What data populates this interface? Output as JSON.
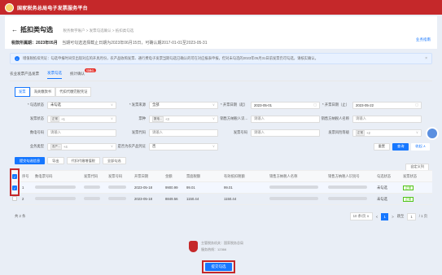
{
  "app": {
    "title": "国家税务总局电子发票服务平台"
  },
  "header": {
    "back_label": "抵扣类勾选",
    "breadcrumb": "税务数字账户 > 发票勾选确认 > 抵扣类勾选",
    "period_label": "税款所属期：",
    "period_value": "2023年05月",
    "period_note": "当期可勾选选择截止日期为2023年06月15日，可确认期2017-01-01至2023-05-31",
    "help": "业务指南"
  },
  "notice": {
    "text": "增值税抵扣凭证：勾选申报时间仅出现对应的开具月份，农产品收购发票、通行费电子发票当期勾选已确认的可在对应报表申报，但对未勾选的2023年05月31日前发票仍可勾选，请核实确认。",
    "close": "×"
  },
  "tabs_main": [
    {
      "label": "农业发票产品发票",
      "active": false
    },
    {
      "label": "发票勾选",
      "active": true
    },
    {
      "label": "统计确认",
      "active": false,
      "badge": "待确认"
    }
  ],
  "tabs_sub": [
    "发票",
    "海关缴款书",
    "代扣代缴完税凭证"
  ],
  "form": {
    "row1": [
      {
        "label": "* 勾选状态",
        "value": "未勾选",
        "suffix": "∨",
        "is_value": true
      },
      {
        "label": "* 发票来源",
        "value": "全部",
        "suffix": "∨",
        "is_value": true
      },
      {
        "label": "* 开票日期（起）",
        "value": "2023-05-01",
        "suffix": "▢",
        "is_value": true
      },
      {
        "label": "* 开票日期（止）",
        "value": "2023-05-22",
        "suffix": "▢",
        "is_value": true
      }
    ],
    "row2": [
      {
        "label": "发票状态",
        "tag": "正常",
        "value": "+1",
        "suffix": "∨"
      },
      {
        "label": "票种",
        "tag": "数电...",
        "value": "+3",
        "suffix": "∨"
      },
      {
        "label": "销售方纳税人识...",
        "value": "请输入",
        "suffix": ""
      },
      {
        "label": "销售方纳税人名称",
        "value": "请输入",
        "suffix": ""
      }
    ],
    "row3": [
      {
        "label": "数电号码",
        "value": "请输入",
        "suffix": ""
      },
      {
        "label": "发票代码",
        "value": "请输入",
        "suffix": ""
      },
      {
        "label": "发票号码",
        "value": "请输入",
        "suffix": ""
      },
      {
        "label": "发票风险等级",
        "tag": "正常",
        "value": "+2",
        "suffix": "∨"
      }
    ],
    "row4": [
      {
        "label": "业务类型",
        "tag": "农产...",
        "value": "+4",
        "suffix": "∨"
      },
      {
        "label": "是否为农产品凭证",
        "value": "否",
        "suffix": "∨",
        "is_value": true
      }
    ],
    "reset": "重置",
    "search": "查询",
    "collapse": "收起 ∧"
  },
  "toolbar": {
    "submit_checked": "提交勾选信息",
    "export": "导出",
    "agent_tax": "代扣代缴增值税",
    "all_check": "全部勾选",
    "custom_cols": "自定义列"
  },
  "table": {
    "headers": [
      "序号",
      "数电票号码",
      "发票代码",
      "发票号码",
      "开票日期",
      "金额",
      "票面税额",
      "有效抵扣税额",
      "销售方纳税人名称",
      "销售方纳税人识别号",
      "勾选状态",
      "发票状态"
    ],
    "rows": [
      {
        "no": "1",
        "date": "2023-05-18",
        "amount": "9900.99",
        "tax": "99.01",
        "eff_tax": "99.01",
        "check_status": "未勾选",
        "status": "正常"
      },
      {
        "no": "2",
        "date": "2023-05-18",
        "amount": "8849.56",
        "tax": "1150.44",
        "eff_tax": "1150.44",
        "check_status": "未勾选",
        "status": "正常"
      }
    ]
  },
  "pager": {
    "total": "共 2 条",
    "page_size": "10 条/页 ∨",
    "prev": "<",
    "current": "1",
    "next": ">",
    "goto_label": "跳至",
    "goto_value": "1",
    "pages": "/ 1 页"
  },
  "footer": {
    "line1": "主管税务机关：国家税务总局",
    "line2": "服务热线：12366"
  },
  "submit_button": "提交勾选"
}
